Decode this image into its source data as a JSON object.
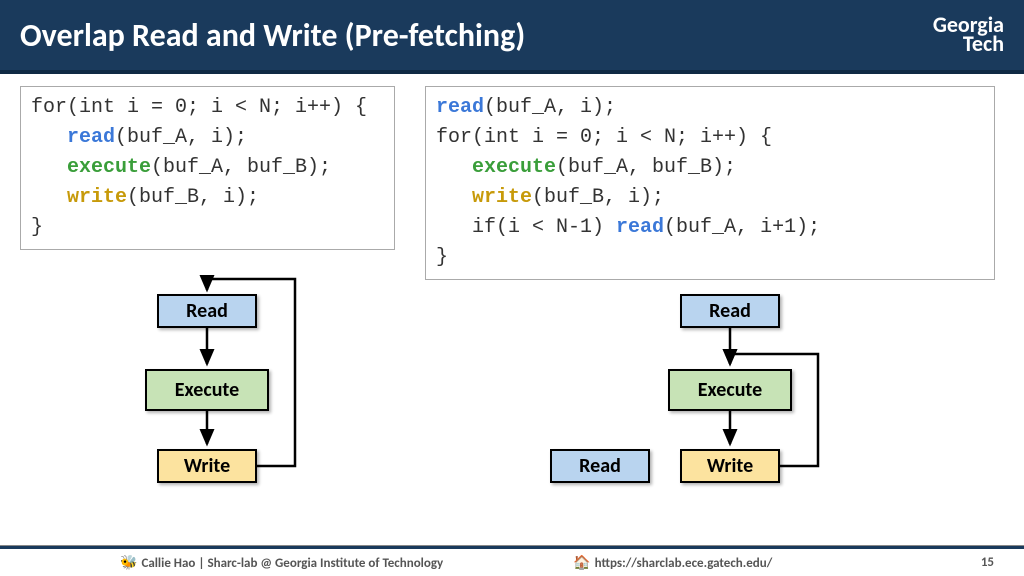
{
  "header": {
    "title": "Overlap Read and Write (Pre-fetching)",
    "logo_line1": "Georgia",
    "logo_line2": "Tech"
  },
  "code_left": {
    "l1a": "for(int i = 0; i < N; i++) {",
    "l2a": "   ",
    "l2b": "read",
    "l2c": "(buf_A, i);",
    "l3a": "   ",
    "l3b": "execute",
    "l3c": "(buf_A, buf_B);",
    "l4a": "   ",
    "l4b": "write",
    "l4c": "(buf_B, i);",
    "l5a": "}"
  },
  "code_right": {
    "l1a": "read",
    "l1b": "(buf_A, i);",
    "l2a": "for(int i = 0; i < N; i++) {",
    "l3a": "   ",
    "l3b": "execute",
    "l3c": "(buf_A, buf_B);",
    "l4a": "   ",
    "l4b": "write",
    "l4c": "(buf_B, i);",
    "l5a": "   if(i < N-1) ",
    "l5b": "read",
    "l5c": "(buf_A, i+1);",
    "l6a": "}"
  },
  "boxes": {
    "read": "Read",
    "execute": "Execute",
    "write": "Write"
  },
  "footer": {
    "author": "Callie Hao | Sharc-lab @ Georgia Institute of Technology",
    "url": "https://sharclab.ece.gatech.edu/",
    "page": "15"
  }
}
